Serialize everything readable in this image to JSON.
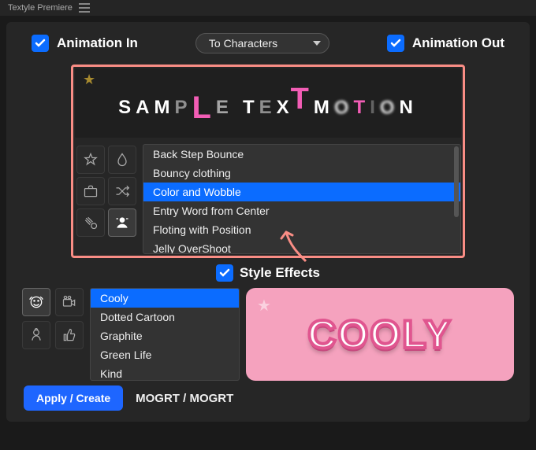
{
  "titlebar": {
    "app_name": "Textyle Premiere"
  },
  "top": {
    "anim_in_label": "Animation In",
    "anim_out_label": "Animation Out",
    "distribute_label": "To Characters"
  },
  "preview": {
    "text": "SAMPLE TEXT MOTION"
  },
  "animations": {
    "items": [
      {
        "label": "Back Step Bounce"
      },
      {
        "label": "Bouncy clothing"
      },
      {
        "label": "Color and Wobble"
      },
      {
        "label": "Entry Word from Center"
      },
      {
        "label": "Floting with Position"
      },
      {
        "label": "Jelly OverShoot"
      }
    ],
    "selected_index": 2
  },
  "style_effects": {
    "label": "Style Effects"
  },
  "styles": {
    "items": [
      {
        "label": "Cooly"
      },
      {
        "label": "Dotted Cartoon"
      },
      {
        "label": "Graphite"
      },
      {
        "label": "Green Life"
      },
      {
        "label": "Kind"
      }
    ],
    "selected_index": 0,
    "preview_text": "COOLY"
  },
  "footer": {
    "apply_label": "Apply / Create",
    "mogrt_label": "MOGRT / MOGRT"
  }
}
